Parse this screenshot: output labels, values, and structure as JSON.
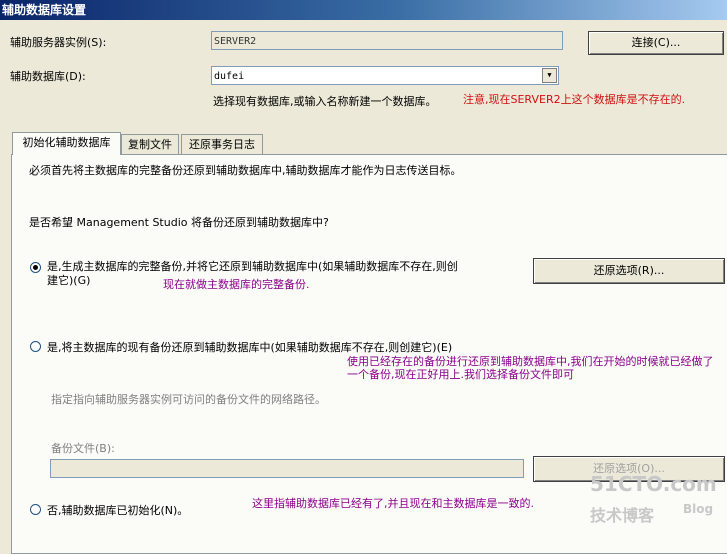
{
  "title": "辅助数据库设置",
  "server": {
    "label": "辅助服务器实例(S):",
    "value": "SERVER2",
    "connect_label": "连接(C)..."
  },
  "database": {
    "label": "辅助数据库(D):",
    "value": "dufei",
    "hint": "选择现有数据库,或输入名称新建一个数据库。",
    "note": "注意,现在SERVER2上这个数据库是不存在的."
  },
  "tabs": [
    {
      "label": "初始化辅助数据库"
    },
    {
      "label": "复制文件"
    },
    {
      "label": "还原事务日志"
    }
  ],
  "panel": {
    "intro": "必须首先将主数据库的完整备份还原到辅助数据库中,辅助数据库才能作为日志传送目标。",
    "question": "是否希望 Management Studio 将备份还原到辅助数据库中?",
    "option1_line1": "是,生成主数据库的完整备份,并将它还原到辅助数据库中(如果辅助数据库不存在,则创",
    "option1_line2": "建它)(G)",
    "option1_note": "现在就做主数据库的完整备份.",
    "restore_options_label": "还原选项(R)...",
    "option2": "是,将主数据库的现有备份还原到辅助数据库中(如果辅助数据库不存在,则创建它)(E)",
    "option2_note": "使用已经存在的备份进行还原到辅助数据库中,我们在开始的时候就已经做了一个备份,现在正好用上.我们选择备份文件即可",
    "path_hint": "指定指向辅助服务器实例可访问的备份文件的网络路径。",
    "backup_file_label": "备份文件(B):",
    "backup_file_value": "",
    "restore_options2_label": "还原选项(O)...",
    "option3": "否,辅助数据库已初始化(N)。",
    "option3_note": "这里指辅助数据库已经有了,并且现在和主数据库是一致的."
  },
  "watermark": {
    "text1": "51CTO.com",
    "text2": "技术博客",
    "text3": "Blog"
  }
}
